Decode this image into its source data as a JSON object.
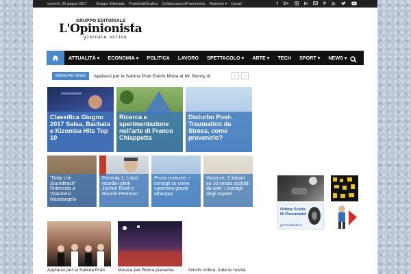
{
  "topbar": {
    "date": "venerdì, 30 giugno 2017",
    "links": [
      "Gruppo Editoriale",
      "Pubblicità/Grafica",
      "Collaborazioni/Partnership",
      "Rubriche ▾",
      "Canali"
    ],
    "social_icons": [
      "facebook-icon",
      "googleplus-icon",
      "instagram-icon",
      "linkedin-icon",
      "mail-icon",
      "pinterest-icon",
      "rss-icon",
      "twitter-icon",
      "youtube-icon"
    ]
  },
  "logo": {
    "small": "GRUPPO EDITORIALE",
    "main": "L'Opinionista",
    "sub": "giornale online",
    "reg": "®"
  },
  "nav": {
    "items": [
      "ATTUALITÀ ▾",
      "ECONOMIA ▾",
      "POLITICA",
      "LAVORO",
      "SPETTACOLO ▾",
      "ARTE ▾",
      "TECH",
      "SPORT ▾",
      "NEWS ▾"
    ]
  },
  "breaking": {
    "badge": "BREAKING NEWS",
    "text": "Applausi per la Sabina Prati Eventi Moda al Mr. Benny di"
  },
  "arrows": {
    "prev": "‹",
    "next": "›"
  },
  "big_tiles": [
    "Classifica Giugno 2017 Salsa, Bachata e Kizomba Hits Top 10",
    "Ricerca e sperimentazione nell'arte di Franco Chiappetta",
    "Disturbo Post-Traumatico da Stress, come prevenirlo?"
  ],
  "mid_tiles": [
    "\"Daily Life Soundtrack\" l'intervista a Vitantonio Mastrangelo",
    "Formula 1, Lotus ricorda i piloti Jochen Rindt e Ronnie Peterson",
    "Prova costume, i consigli su come superarla grazie all'acqua",
    "Vacanze, 3 italiani su 10 senza occhiali da sole: i consigli degli esperti"
  ],
  "bottom_tiles": [
    "Applausi per la Sabina Prati",
    "Musica per Roma presenta",
    "Giochi online, tutte le novità"
  ],
  "ads": {
    "tire_line1": "Ottima Scelta",
    "tire_line2": "Di Pneumatici",
    "tire_brand": "gommadiretto.it"
  }
}
